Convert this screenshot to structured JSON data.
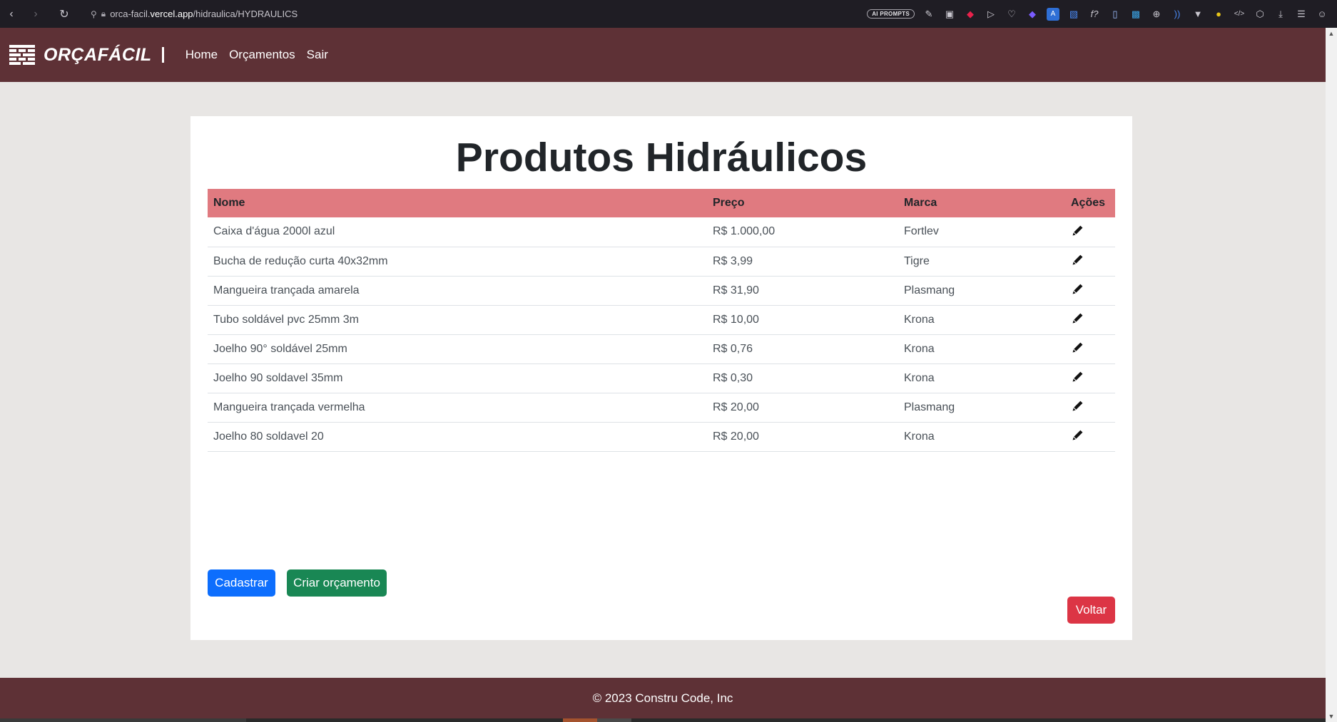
{
  "browser": {
    "url_prefix": "orca-facil.",
    "url_domain": "vercel.app",
    "url_path": "/hidraulica/HYDRAULICS",
    "ai_badge": "AI PROMPTS"
  },
  "navbar": {
    "brand": "ORÇAFÁCIL",
    "links": [
      "Home",
      "Orçamentos",
      "Sair"
    ]
  },
  "page": {
    "title": "Produtos Hidráulicos"
  },
  "table": {
    "headers": [
      "Nome",
      "Preço",
      "Marca",
      "Ações"
    ],
    "rows": [
      {
        "nome": "Caixa d'água 2000l azul",
        "preco": "R$ 1.000,00",
        "marca": "Fortlev"
      },
      {
        "nome": "Bucha de redução curta 40x32mm",
        "preco": "R$ 3,99",
        "marca": "Tigre"
      },
      {
        "nome": "Mangueira trançada amarela",
        "preco": "R$ 31,90",
        "marca": "Plasmang"
      },
      {
        "nome": "Tubo soldável pvc 25mm 3m",
        "preco": "R$ 10,00",
        "marca": "Krona"
      },
      {
        "nome": "Joelho 90° soldável 25mm",
        "preco": "R$ 0,76",
        "marca": "Krona"
      },
      {
        "nome": "Joelho 90 soldavel 35mm",
        "preco": "R$ 0,30",
        "marca": "Krona"
      },
      {
        "nome": "Mangueira trançada vermelha",
        "preco": "R$ 20,00",
        "marca": "Plasmang"
      },
      {
        "nome": "Joelho 80 soldavel 20",
        "preco": "R$ 20,00",
        "marca": "Krona"
      }
    ]
  },
  "actions": {
    "cadastrar": "Cadastrar",
    "criar_orcamento": "Criar orçamento",
    "voltar": "Voltar"
  },
  "footer": {
    "text": "© 2023 Constru Code, Inc"
  },
  "colors": {
    "brand": "#5e3136",
    "table_header": "#e07a80",
    "primary": "#0d6efd",
    "success": "#198754",
    "danger": "#dc3545"
  }
}
